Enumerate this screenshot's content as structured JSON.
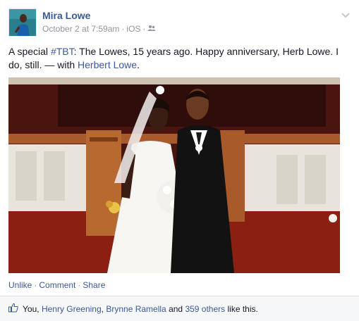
{
  "post": {
    "author": "Mira Lowe",
    "timestamp": "October 2 at 7:59am",
    "meta_sep": "·",
    "source": "iOS",
    "text_prefix": "A special ",
    "hashtag": "#TBT",
    "text_body": ": The Lowes, 15 years ago. Happy anniversary, Herb Lowe. I do, still. — with ",
    "tagged": "Herbert Lowe",
    "text_end": "."
  },
  "actions": {
    "unlike": "Unlike",
    "comment": "Comment",
    "share": "Share",
    "sep": "·"
  },
  "likes": {
    "you": "You",
    "comma": ",",
    "person1": "Henry Greening",
    "person2": "Brynne Ramella",
    "and": "and",
    "others": "359 others",
    "tail": "like this."
  },
  "icons": {
    "audience": "friends-icon",
    "menu": "chevron-down-icon",
    "like": "thumbs-up-icon"
  },
  "colors": {
    "link": "#3b5998",
    "meta": "#90949c",
    "bar_bg": "#f6f7f9"
  }
}
